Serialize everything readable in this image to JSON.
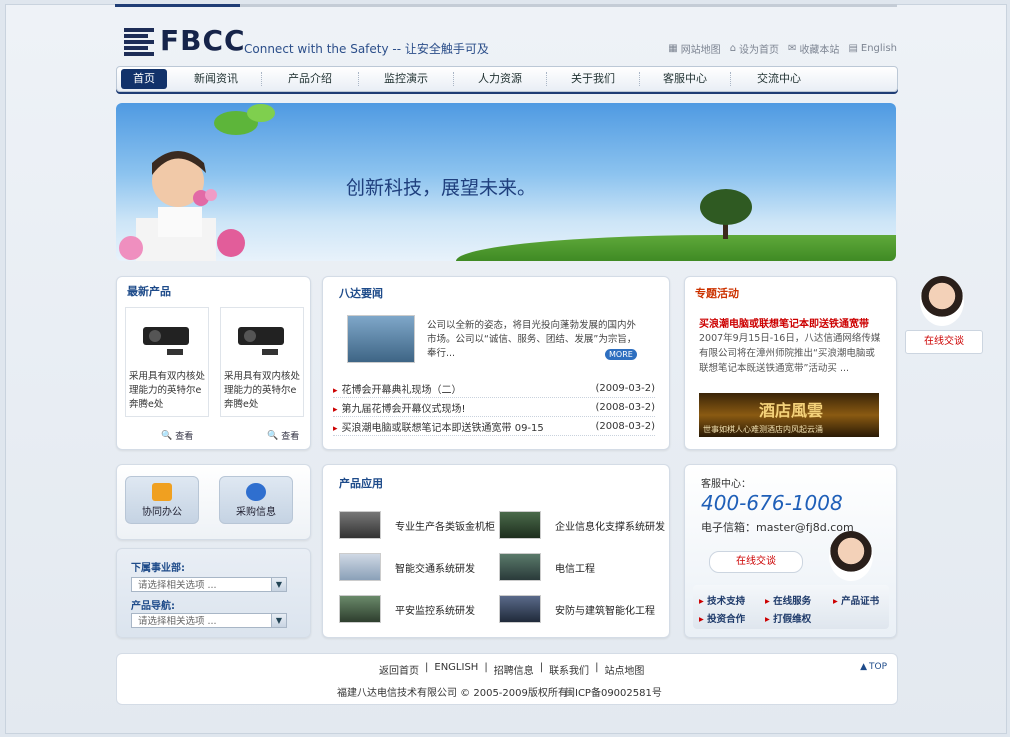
{
  "header": {
    "logo_text": "FBCC",
    "slogan": "Connect with the Safety  -- 让安全触手可及",
    "top_links": [
      {
        "label": "网站地图",
        "icon": "sitemap-icon"
      },
      {
        "label": "设为首页",
        "icon": "home-icon"
      },
      {
        "label": "收藏本站",
        "icon": "bookmark-icon"
      },
      {
        "label": "English",
        "icon": "page-icon"
      }
    ]
  },
  "nav": {
    "items": [
      "首页",
      "新闻资讯",
      "产品介绍",
      "监控演示",
      "人力资源",
      "关于我们",
      "客服中心",
      "交流中心"
    ]
  },
  "banner": {
    "headline": "创新科技，展望未来。"
  },
  "latest_products": {
    "title": "最新产品",
    "cards": [
      {
        "text": "采用具有双内核处理能力的英特尔e奔腾e处"
      },
      {
        "text": "采用具有双内核处理能力的英特尔e奔腾e处"
      }
    ],
    "view_label": "查看"
  },
  "news": {
    "title": "八达要闻",
    "summary": "公司以全新的姿态，将目光投向蓬勃发展的国内外市场。公司以“诚信、服务、团结、发展”为宗旨，奉行...",
    "more_label": "MORE",
    "items": [
      {
        "title": "花博会开幕典礼现场（二）",
        "date": "(2009-03-2)"
      },
      {
        "title": "第九届花博会开幕仪式现场!",
        "date": "(2008-03-2)"
      },
      {
        "title": "买浪潮电脑或联想笔记本即送铁通宽带 09-15",
        "date": "(2008-03-2)"
      }
    ]
  },
  "special": {
    "title": "专题活动",
    "headline": "买浪潮电脑或联想笔记本即送铁通宽带",
    "body": "2007年9月15日-16日，八达信通网络传媒有限公司将在漳州师院推出“买浪潮电脑或联想笔记本既送铁通宽带”活动买  ...",
    "ad_text": "酒店風雲",
    "ad_caption": "世事如棋人心难测酒店内风起云涌"
  },
  "online_chat": {
    "label": "在线交谈"
  },
  "quick": {
    "office_label": "协同办公",
    "purchase_label": "采购信息",
    "sub_label": "下属事业部:",
    "sub_select": "请选择相关选项      ...",
    "prod_label": "产品导航:",
    "prod_select": "请选择相关选项      ..."
  },
  "apps": {
    "title": "产品应用",
    "items": [
      "专业生产各类钣金机柜",
      "企业信息化支撑系统研发",
      "智能交通系统研发",
      "电信工程",
      "平安监控系统研发",
      "安防与建筑智能化工程"
    ]
  },
  "service": {
    "label": "客服中心：",
    "phone": "400-676-1008",
    "email": "电子信箱：master@fj8d.com",
    "chat_label": "在线交谈",
    "links": [
      "技术支持",
      "在线服务",
      "产品证书",
      "投资合作",
      "打假维权"
    ]
  },
  "footer": {
    "links": [
      "返回首页",
      "ENGLISH",
      "招聘信息",
      "联系我们",
      "站点地图"
    ],
    "top_label": "TOP",
    "copyright": "福建八达电信技术有限公司 © 2005-2009版权所有",
    "icp": "闽ICP备09002581号"
  },
  "colors": {
    "brand_navy": "#12326a",
    "accent_red": "#cc0000",
    "link_blue": "#1e4b8a"
  }
}
